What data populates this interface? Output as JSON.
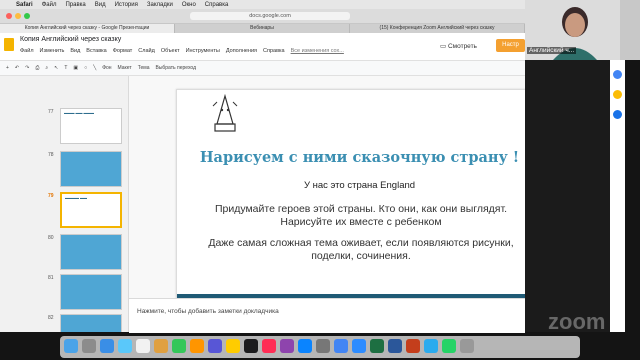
{
  "menubar": {
    "app": "Safari",
    "items": [
      "Файл",
      "Правка",
      "Вид",
      "История",
      "Закладки",
      "Окно",
      "Справка"
    ]
  },
  "browser": {
    "address": "docs.google.com",
    "tabs": [
      {
        "label": "Копия Английский через сказку - Google Презентации",
        "active": true
      },
      {
        "label": "Вебинары",
        "active": false
      },
      {
        "label": "(15) Конференция Zoom Английский через сказку",
        "active": false
      }
    ]
  },
  "app": {
    "title": "Копия Английский через сказку",
    "menu": [
      "Файл",
      "Изменить",
      "Вид",
      "Вставка",
      "Формат",
      "Слайд",
      "Объект",
      "Инструменты",
      "Дополнения",
      "Справка"
    ],
    "changes_link": "Все изменения сох...",
    "show_label": "Смотреть",
    "access_label": "Настр",
    "toolbar": {
      "background": "Фон",
      "layout": "Макет",
      "theme": "Тема",
      "transition": "Выбрать переход"
    }
  },
  "filmstrip": {
    "slides": [
      {
        "num": "77",
        "active": false,
        "style": "white"
      },
      {
        "num": "78",
        "active": false,
        "style": "blue"
      },
      {
        "num": "79",
        "active": true,
        "style": "white"
      },
      {
        "num": "80",
        "active": false,
        "style": "blue"
      },
      {
        "num": "81",
        "active": false,
        "style": "blue"
      },
      {
        "num": "82",
        "active": false,
        "style": "blue"
      }
    ]
  },
  "slide": {
    "title": "Нарисуем с ними сказочную страну !",
    "subtitle": "У нас это страна England",
    "paragraph1": "Придумайте героев этой страны. Кто они, как они выглядят. Нарисуйте их вместе с ребенком",
    "paragraph2": "Даже самая сложная тема оживает, если появляются рисунки, поделки, сочинения."
  },
  "notes": {
    "placeholder": "Нажмите, чтобы добавить заметки докладчика"
  },
  "video": {
    "label": "Английский ч..."
  },
  "zoom": {
    "watermark": "zoom"
  },
  "colors": {
    "accent_title": "#3b8fb2",
    "slide_bar": "#1f5a75",
    "access_button": "#f4a030",
    "slides_icon": "#f4b400"
  }
}
